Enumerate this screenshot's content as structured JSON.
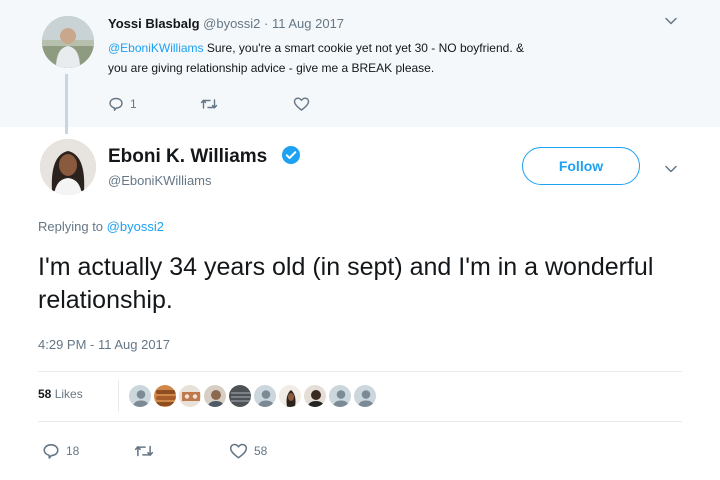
{
  "parent_tweet": {
    "name": "Yossi Blasbalg",
    "handle": "@byossi2",
    "separator": " · ",
    "date": "11 Aug 2017",
    "mention": "@EboniKWilliams",
    "text_line1": " Sure, you're a smart cookie yet not yet 30 - NO boyfriend. &",
    "text_line2": "you are giving relationship advice - give me a BREAK please.",
    "reply_count": "1",
    "retweet_count": "",
    "like_count": ""
  },
  "main_tweet": {
    "name": "Eboni K. Williams",
    "handle": "@EboniKWilliams",
    "follow_label": "Follow",
    "replying_prefix": "Replying to ",
    "replying_to": "@byossi2",
    "text": "I'm actually 34 years old (in sept) and I'm in a wonderful relationship.",
    "timestamp": "4:29 PM - 11 Aug 2017",
    "likes_count": "58",
    "likes_label": " Likes",
    "reply_count": "18",
    "retweet_count": "",
    "like_count": "58"
  },
  "colors": {
    "accent": "#1da1f2",
    "text": "#14171a",
    "muted": "#657786",
    "parent_background": "#f5f8fa",
    "thread_line": "#c4d7e6"
  },
  "icons": [
    "verified-badge-icon",
    "chevron-down-icon",
    "reply-icon",
    "retweet-icon",
    "heart-icon"
  ]
}
